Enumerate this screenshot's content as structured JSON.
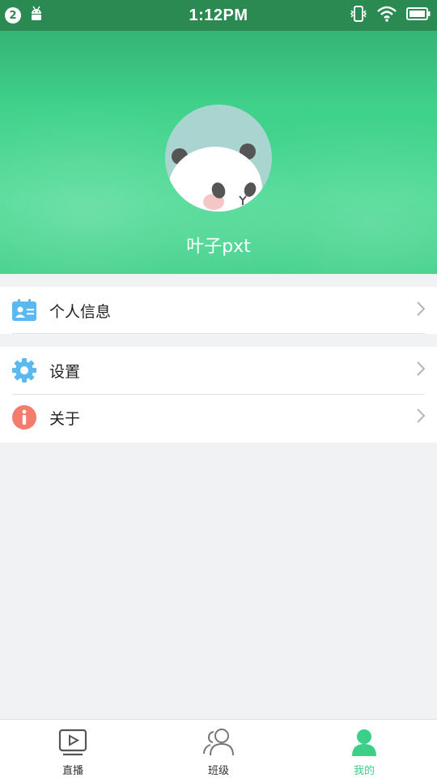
{
  "status_bar": {
    "notification_count": "2",
    "time": "1:12PM",
    "icons": [
      "notification-badge",
      "android-icon",
      "vibrate-icon",
      "wifi-icon",
      "battery-icon"
    ]
  },
  "profile": {
    "username": "叶子pxt",
    "avatar": "panda-avatar"
  },
  "menu": {
    "groups": [
      [
        {
          "label": "个人信息",
          "icon": "id-card-icon",
          "icon_color": "#5bb8f0"
        }
      ],
      [
        {
          "label": "设置",
          "icon": "gear-icon",
          "icon_color": "#5bb8f0"
        },
        {
          "label": "关于",
          "icon": "info-icon",
          "icon_color": "#f47c6c"
        }
      ]
    ]
  },
  "tabs": [
    {
      "label": "直播",
      "icon": "live-play-icon",
      "active": false
    },
    {
      "label": "班级",
      "icon": "class-people-icon",
      "active": false
    },
    {
      "label": "我的",
      "icon": "profile-person-icon",
      "active": true
    }
  ],
  "colors": {
    "accent": "#3ccf87",
    "status_bar": "#2a8a52",
    "background": "#f1f2f4"
  }
}
